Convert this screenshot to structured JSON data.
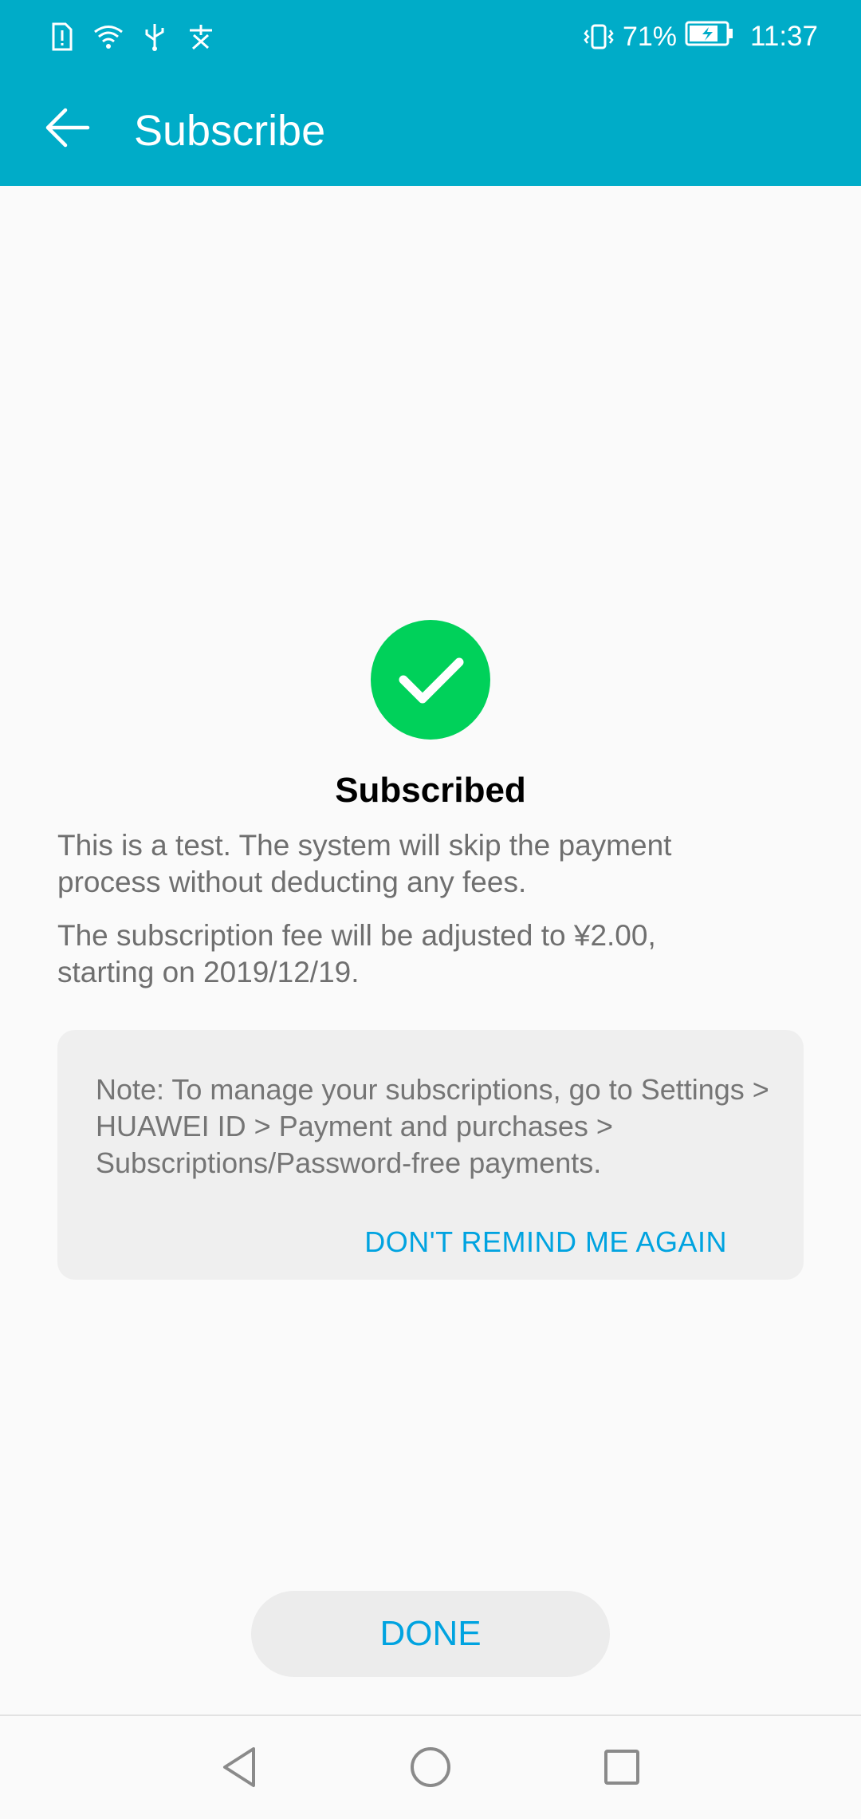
{
  "status_bar": {
    "battery_percent": "71%",
    "time": "11:37",
    "icons": [
      "sim-alert-icon",
      "wifi-icon",
      "usb-icon",
      "translate-icon",
      "vibrate-icon",
      "battery-charging-icon"
    ]
  },
  "app_bar": {
    "title": "Subscribe",
    "back_icon": "arrow-left-icon"
  },
  "result": {
    "icon": "check-circle-icon",
    "title": "Subscribed",
    "message1": "This is a test. The system will skip the payment process without deducting any fees.",
    "message2": "The subscription fee will be adjusted to ¥2.00, starting on 2019/12/19."
  },
  "note": {
    "text": "Note: To manage your subscriptions, go to Settings > HUAWEI ID > Payment and purchases > Subscriptions/Password-free payments.",
    "dismiss_label": "DON'T REMIND ME AGAIN"
  },
  "actions": {
    "done_label": "DONE"
  },
  "nav_bar": {
    "icons": [
      "nav-back-icon",
      "nav-home-icon",
      "nav-recent-icon"
    ]
  },
  "colors": {
    "app_bar": "#00acc8",
    "success": "#00d15a",
    "accent": "#00a3e0"
  }
}
